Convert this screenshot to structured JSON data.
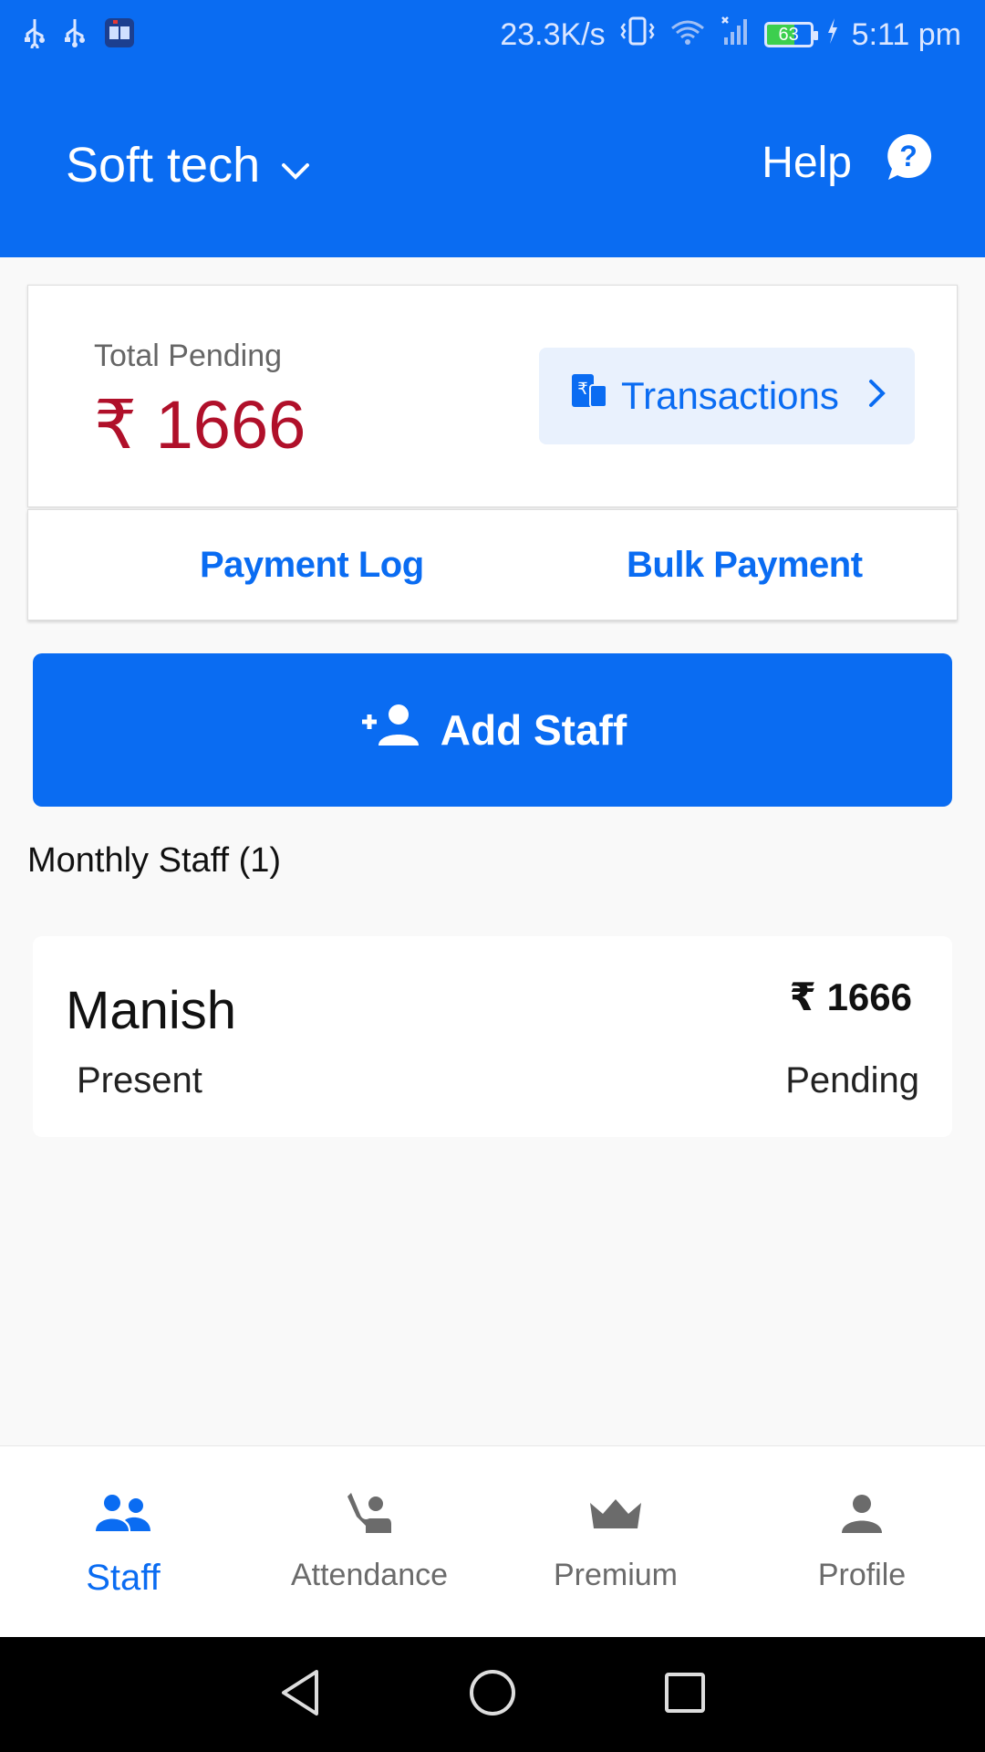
{
  "status_bar": {
    "network_speed": "23.3K/s",
    "battery_level": "63",
    "time": "5:11 pm",
    "icons": [
      "usb-icon",
      "usb-icon",
      "book-app-icon",
      "vibrate-icon",
      "wifi-icon",
      "signal-icon",
      "battery-icon",
      "charging-icon"
    ]
  },
  "header": {
    "company_name": "Soft tech",
    "help_label": "Help",
    "color": "#0a6cf2"
  },
  "summary": {
    "pending_label": "Total Pending",
    "pending_amount": "₹ 1666",
    "transactions_label": "Transactions"
  },
  "actions": {
    "payment_log": "Payment Log",
    "bulk_payment": "Bulk Payment",
    "add_staff": "Add Staff"
  },
  "staff_section": {
    "title": "Monthly Staff (1)",
    "staff": [
      {
        "name": "Manish",
        "amount": "₹ 1666",
        "attendance": "Present",
        "payment_status": "Pending"
      }
    ]
  },
  "bottom_nav": {
    "items": [
      {
        "label": "Staff",
        "icon": "staff-icon",
        "active": true
      },
      {
        "label": "Attendance",
        "icon": "attendance-icon",
        "active": false
      },
      {
        "label": "Premium",
        "icon": "crown-icon",
        "active": false
      },
      {
        "label": "Profile",
        "icon": "profile-icon",
        "active": false
      }
    ]
  },
  "colors": {
    "primary": "#0a6cf2",
    "pending_amount": "#b0102a",
    "transactions_bg": "#e9f1fd"
  }
}
